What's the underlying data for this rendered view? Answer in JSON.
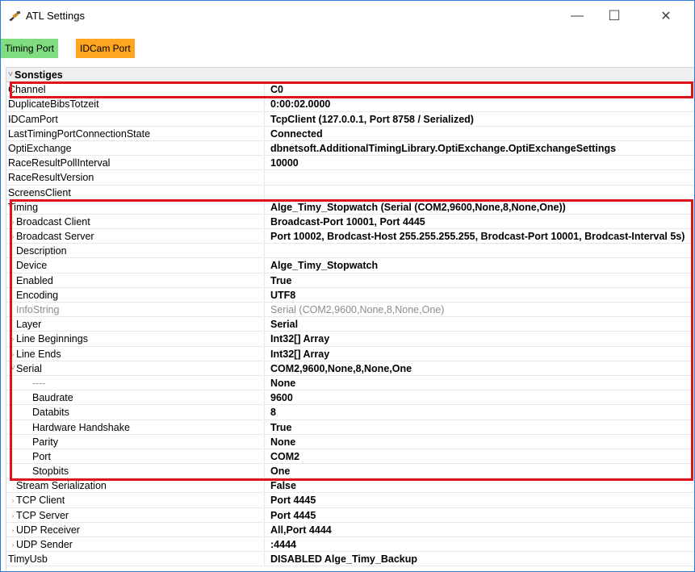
{
  "window": {
    "title": "ATL Settings",
    "minimize_glyph": "—",
    "maximize_glyph": "☐",
    "close_glyph": "✕"
  },
  "toolbar": {
    "timing_port_label": "Timing Port",
    "timing_port_color": "#7fdc7f",
    "idcam_port_label": "IDCam Port",
    "idcam_port_color": "#ffa51f"
  },
  "properties": [
    {
      "name": "Sonstiges",
      "value": "",
      "level": 0,
      "expander": "down",
      "category": true
    },
    {
      "name": "Channel",
      "value": "C0",
      "level": 0,
      "expander": ""
    },
    {
      "name": "DuplicateBibsTotzeit",
      "value": "0:00:02.0000",
      "level": 0,
      "expander": "right"
    },
    {
      "name": "IDCamPort",
      "value": "TcpClient (127.0.0.1, Port 8758 / Serialized)",
      "level": 0,
      "expander": "right"
    },
    {
      "name": "LastTimingPortConnectionState",
      "value": "Connected",
      "level": 0,
      "expander": ""
    },
    {
      "name": "OptiExchange",
      "value": "dbnetsoft.AdditionalTimingLibrary.OptiExchange.OptiExchangeSettings",
      "level": 0,
      "expander": "right"
    },
    {
      "name": "RaceResultPollInterval",
      "value": "10000",
      "level": 0,
      "expander": ""
    },
    {
      "name": "RaceResultVersion",
      "value": "",
      "level": 0,
      "expander": ""
    },
    {
      "name": "ScreensClient",
      "value": "",
      "level": 0,
      "expander": ""
    },
    {
      "name": "Timing",
      "value": "Alge_Timy_Stopwatch (Serial (COM2,9600,None,8,None,One))",
      "level": 0,
      "expander": "down"
    },
    {
      "name": "Broadcast Client",
      "value": "Broadcast-Port 10001, Port 4445",
      "level": 1,
      "expander": "right"
    },
    {
      "name": "Broadcast Server",
      "value": "Port 10002, Brodcast-Host 255.255.255.255, Brodcast-Port 10001, Brodcast-Interval 5s)",
      "level": 1,
      "expander": "right"
    },
    {
      "name": "Description",
      "value": "",
      "level": 1,
      "expander": ""
    },
    {
      "name": "Device",
      "value": "Alge_Timy_Stopwatch",
      "level": 1,
      "expander": ""
    },
    {
      "name": "Enabled",
      "value": "True",
      "level": 1,
      "expander": ""
    },
    {
      "name": "Encoding",
      "value": "UTF8",
      "level": 1,
      "expander": ""
    },
    {
      "name": "InfoString",
      "value": "Serial (COM2,9600,None,8,None,One)",
      "level": 1,
      "expander": "",
      "readonly": true
    },
    {
      "name": "Layer",
      "value": "Serial",
      "level": 1,
      "expander": ""
    },
    {
      "name": "Line Beginnings",
      "value": "Int32[] Array",
      "level": 1,
      "expander": "right"
    },
    {
      "name": "Line Ends",
      "value": "Int32[] Array",
      "level": 1,
      "expander": "right"
    },
    {
      "name": "Serial",
      "value": "COM2,9600,None,8,None,One",
      "level": 1,
      "expander": "down"
    },
    {
      "name": "----",
      "value": "None",
      "level": 2,
      "expander": "",
      "dim_name": true
    },
    {
      "name": "Baudrate",
      "value": "9600",
      "level": 2,
      "expander": ""
    },
    {
      "name": "Databits",
      "value": "8",
      "level": 2,
      "expander": ""
    },
    {
      "name": "Hardware Handshake",
      "value": "True",
      "level": 2,
      "expander": ""
    },
    {
      "name": "Parity",
      "value": "None",
      "level": 2,
      "expander": ""
    },
    {
      "name": "Port",
      "value": "COM2",
      "level": 2,
      "expander": ""
    },
    {
      "name": "Stopbits",
      "value": "One",
      "level": 2,
      "expander": ""
    },
    {
      "name": "Stream Serialization",
      "value": "False",
      "level": 1,
      "expander": ""
    },
    {
      "name": "TCP Client",
      "value": "Port 4445",
      "level": 1,
      "expander": "right"
    },
    {
      "name": "TCP Server",
      "value": "Port 4445",
      "level": 1,
      "expander": "right"
    },
    {
      "name": "UDP Receiver",
      "value": "All,Port 4444",
      "level": 1,
      "expander": "right"
    },
    {
      "name": "UDP Sender",
      "value": ":4444",
      "level": 1,
      "expander": "right"
    },
    {
      "name": "TimyUsb",
      "value": "DISABLED Alge_Timy_Backup",
      "level": 0,
      "expander": "right"
    }
  ],
  "highlight_color": "#e0141c"
}
